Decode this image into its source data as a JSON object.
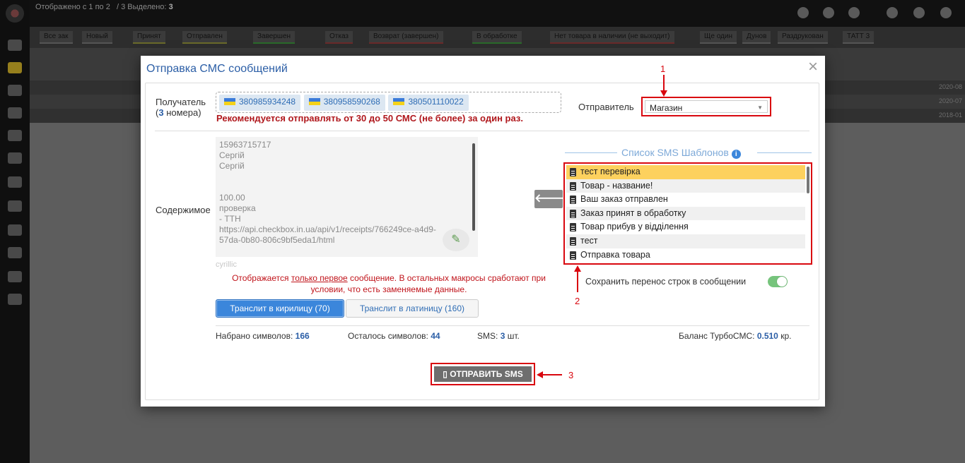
{
  "modal": {
    "title": "Отправка СМС сообщений",
    "close_symbol": "×"
  },
  "recipient": {
    "label": "Получатель",
    "count_open": "(",
    "count": "3",
    "count_suffix": " номера)",
    "numbers": [
      "380985934248",
      "380958590268",
      "380501110022"
    ],
    "warning": "Рекомендуется отправлять от 30 до 50 СМС (не более) за один раз."
  },
  "sender": {
    "label": "Отправитель",
    "value": "Магазин"
  },
  "content": {
    "label": "Содержимое",
    "lines": [
      "15963715717",
      "Сергій",
      "Сергій",
      "",
      "",
      "100.00",
      "проверка",
      "  -  ТТН",
      "https://api.checkbox.in.ua/api/v1/receipts/766249ce-a4d9-",
      "57da-0b80-806c9bf5eda1/html"
    ],
    "charset_tag": "cyrillic",
    "notice_before": "Отображается ",
    "notice_link": "только первое",
    "notice_after": " сообщение. В остальных макросы сработают при условии, что есть заменяемые данные."
  },
  "translit": {
    "cyrillic_label": "Транслит в кирилицу (70)",
    "latin_label": "Транслит в латиницу (160)"
  },
  "stats": {
    "typed_label": "Набрано символов:",
    "typed_value": "166",
    "left_label": "Осталось символов:",
    "left_value": "44",
    "sms_label": "SMS:",
    "sms_value": "3",
    "sms_unit": "шт.",
    "balance_label": "Баланс ТурбоСМС:",
    "balance_value": "0.510",
    "balance_unit": "кр."
  },
  "templates": {
    "legend": "Список SMS Шаблонов",
    "items": [
      "тест перевірка",
      "Товар - название!",
      "Ваш заказ отправлен",
      "Заказ принят в обработку",
      "Товар прибув у відділення",
      "тест",
      "Отправка товара"
    ],
    "selected_index": 0,
    "keep_breaks_label": "Сохранить перенос строк в сообщении",
    "keep_breaks_enabled": true
  },
  "send_button": {
    "label": "ОТПРАВИТЬ SMS"
  },
  "annotations": [
    "1",
    "2",
    "3"
  ],
  "background": {
    "title_prefix": "Отображено с 1 по 2",
    "selected_prefix": "/ 3 Выделено:",
    "selected_count": "3",
    "tabs": [
      "Все зак",
      "Новый",
      "Принят",
      "Отправлен",
      "Завершен",
      "Отказ",
      "Возврат (завершен)",
      "В обработке",
      "Нет товара в наличии (не выходит)",
      "Ще один",
      "Дунов",
      "Раздрукован",
      "ТАТТ 3"
    ],
    "row_values": [
      "2020-08",
      "2020-07",
      "2018-01"
    ]
  },
  "colors": {
    "accent": "#2b5ea6",
    "warning_red": "#b0171c",
    "annotation_red": "#d9070f",
    "selected_template": "#fdd15e",
    "toggle_on": "#76c47c"
  }
}
